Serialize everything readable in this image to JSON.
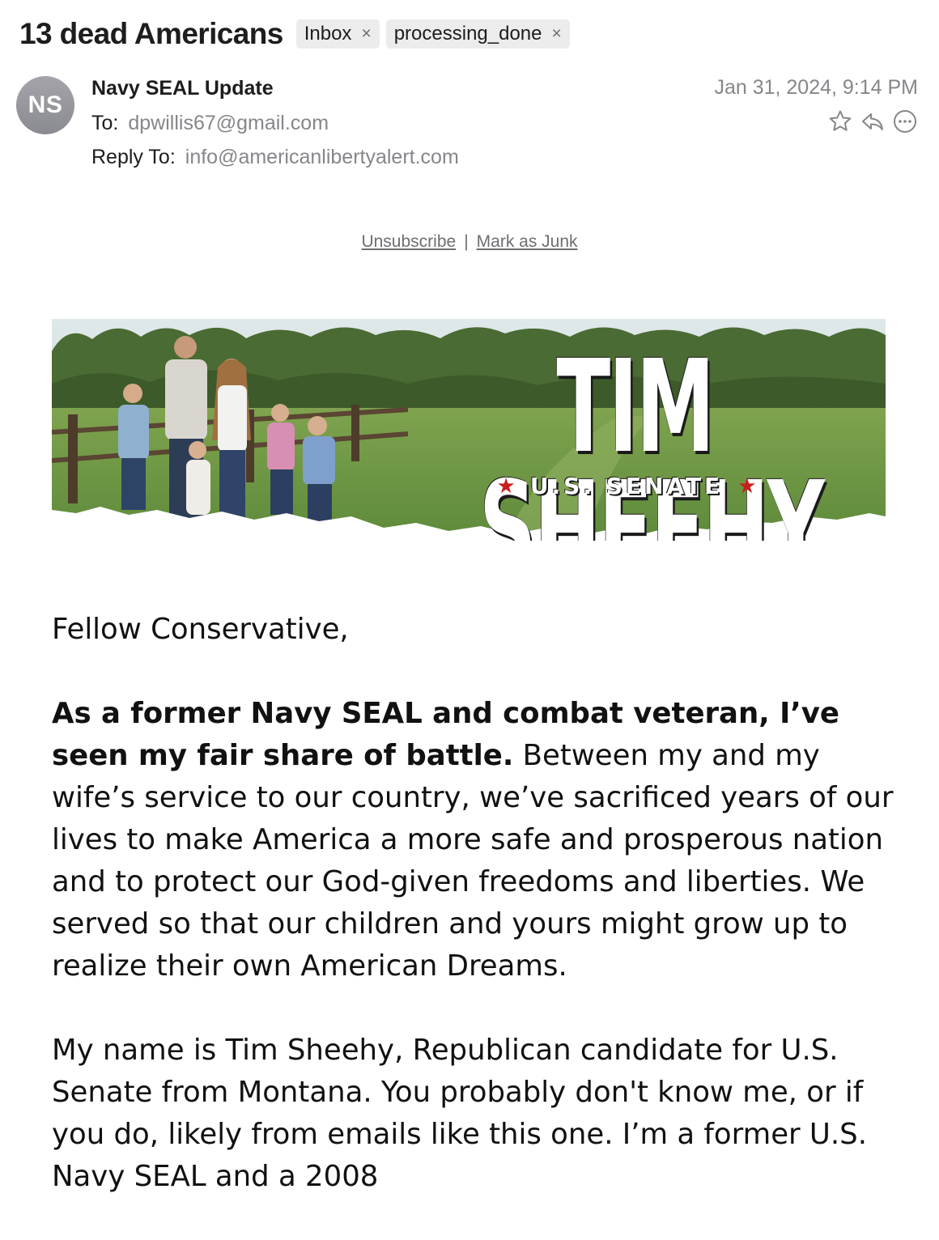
{
  "header": {
    "subject": "13 dead Americans",
    "tags": [
      {
        "label": "Inbox"
      },
      {
        "label": "processing_done"
      }
    ],
    "tag_close_glyph": "×",
    "avatar_initials": "NS",
    "sender_name": "Navy SEAL Update",
    "to_label": "To:",
    "to_value": "dpwillis67@gmail.com",
    "reply_to_label": "Reply To:",
    "reply_to_value": "info@americanlibertyalert.com",
    "date": "Jan 31, 2024, 9:14 PM",
    "action_icons": [
      "star-icon",
      "reply-icon",
      "more-icon"
    ]
  },
  "links": {
    "unsubscribe": "Unsubscribe",
    "separator": "|",
    "mark_junk": "Mark as Junk"
  },
  "banner": {
    "title": "TIM SHEEHY",
    "subtitle": "U.S. SENATE",
    "star_glyph": "★"
  },
  "body": {
    "greeting": "Fellow Conservative,",
    "p1_bold": "As a former Navy SEAL and combat veteran, I’ve seen my fair share of battle.",
    "p1_rest": " Between my and my wife’s service to our country, we’ve sacrificed years of our lives to make America a more safe and prosperous nation and to protect our God-given freedoms and liberties. We served so that our children and yours might grow up to realize their own American Dreams.",
    "p2": "My name is Tim Sheehy, Republican candidate for U.S. Senate from Montana. You probably don't know me, or if you do, likely from emails like this one. I’m a former U.S. Navy SEAL and a 2008"
  },
  "colors": {
    "tag_bg": "#ececec",
    "avatar": "#96969c",
    "secondary_text": "#86868b",
    "banner_star": "#c81e1e"
  }
}
